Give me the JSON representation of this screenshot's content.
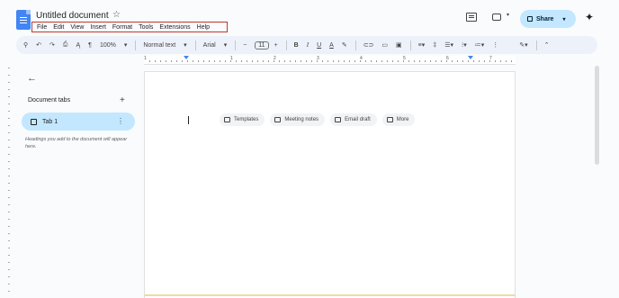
{
  "document": {
    "title": "Untitled document"
  },
  "menu": [
    "File",
    "Edit",
    "View",
    "Insert",
    "Format",
    "Tools",
    "Extensions",
    "Help"
  ],
  "header": {
    "share_label": "Share"
  },
  "toolbar": {
    "zoom": "100%",
    "style": "Normal text",
    "font": "Arial",
    "font_size": "11",
    "minus": "−",
    "plus": "+",
    "bold": "B",
    "italic": "I",
    "underline": "U",
    "text_color": "A"
  },
  "ruler": {
    "numbers": [
      "1",
      "1",
      "2",
      "3",
      "4",
      "5",
      "6",
      "7"
    ]
  },
  "sidebar": {
    "tabs_heading": "Document tabs",
    "tab_label": "Tab 1",
    "hint": "Headings you add to the document will appear here."
  },
  "chips": [
    {
      "label": "Templates",
      "icon": "template-icon"
    },
    {
      "label": "Meeting notes",
      "icon": "meeting-notes-icon"
    },
    {
      "label": "Email draft",
      "icon": "email-draft-icon"
    },
    {
      "label": "More",
      "icon": "more-icon"
    }
  ],
  "colors": {
    "accent": "#c2e7ff",
    "toolbar_bg": "#edf2fa",
    "menu_highlight": "#c0392b"
  }
}
